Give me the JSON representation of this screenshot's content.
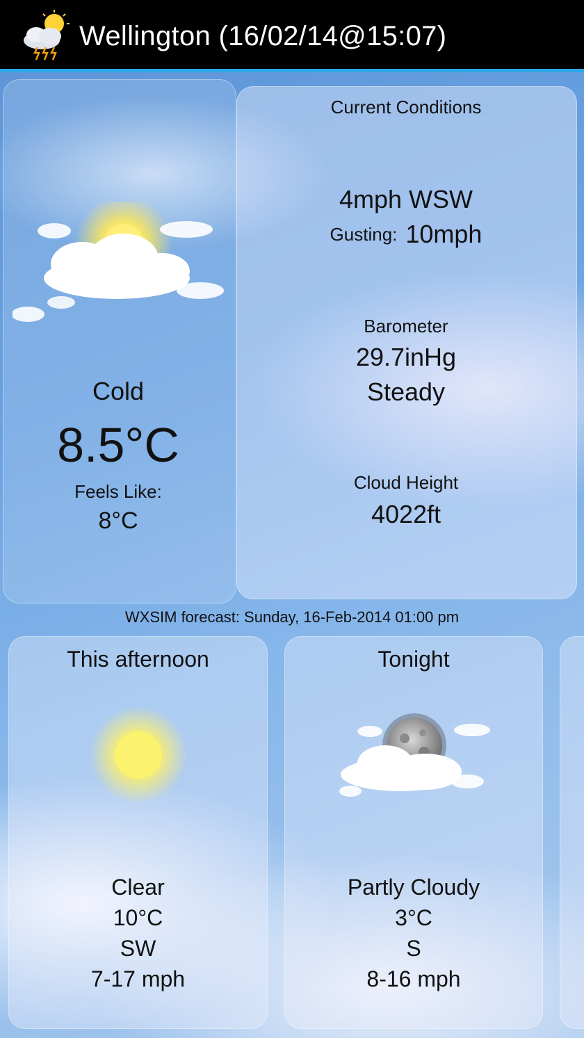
{
  "header": {
    "title": "Wellington (16/02/14@15:07)",
    "app_icon": "storm-cloud-sun-icon"
  },
  "current": {
    "icon": "partly-cloudy-sun-icon",
    "condition": "Cold",
    "temperature": "8.5°C",
    "feels_like_label": "Feels Like:",
    "feels_like_value": "8°C"
  },
  "conditions_panel": {
    "heading": "Current Conditions",
    "wind": "4mph WSW",
    "gusting_label": "Gusting:",
    "gusting_value": "10mph",
    "barometer_label": "Barometer",
    "barometer_value": "29.7inHg",
    "barometer_trend": "Steady",
    "cloud_height_label": "Cloud Height",
    "cloud_height_value": "4022ft"
  },
  "forecast_note": "WXSIM forecast: Sunday, 16-Feb-2014 01:00 pm",
  "forecast": [
    {
      "period": "This afternoon",
      "icon": "sun-icon",
      "condition": "Clear",
      "temp": "10°C",
      "wind_dir": "SW",
      "wind_speed": "7-17 mph"
    },
    {
      "period": "Tonight",
      "icon": "moon-cloud-icon",
      "condition": "Partly Cloudy",
      "temp": "3°C",
      "wind_dir": "S",
      "wind_speed": "8-16 mph"
    }
  ],
  "colors": {
    "header_bg": "#000000",
    "accent": "#2ea8e8",
    "sky": "#6aa3e2"
  }
}
